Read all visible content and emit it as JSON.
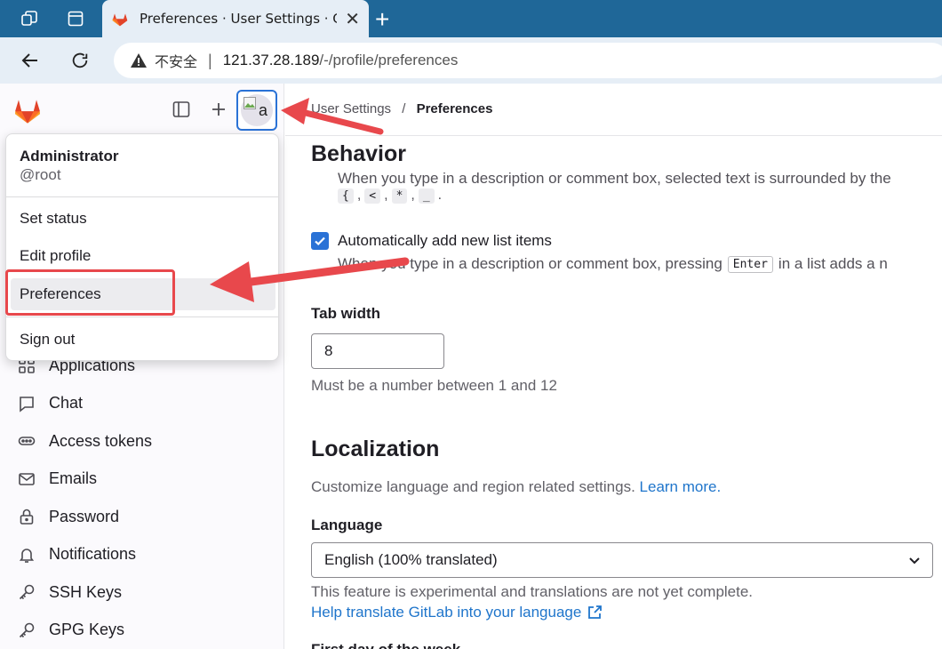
{
  "browser": {
    "tab_title": "Preferences · User Settings · GitLab",
    "security_label": "不安全",
    "url_host": "121.37.28.189",
    "url_path": "/-/profile/preferences"
  },
  "sidebar": {
    "nav_items": [
      {
        "label": "Applications",
        "icon": "applications-icon"
      },
      {
        "label": "Chat",
        "icon": "chat-icon"
      },
      {
        "label": "Access tokens",
        "icon": "token-icon"
      },
      {
        "label": "Emails",
        "icon": "mail-icon"
      },
      {
        "label": "Password",
        "icon": "lock-icon"
      },
      {
        "label": "Notifications",
        "icon": "bell-icon"
      },
      {
        "label": "SSH Keys",
        "icon": "key-icon"
      },
      {
        "label": "GPG Keys",
        "icon": "key-icon"
      }
    ],
    "avatar_alt": "a"
  },
  "user_menu": {
    "name": "Administrator",
    "handle": "@root",
    "items": [
      "Set status",
      "Edit profile",
      "Preferences",
      "Sign out"
    ],
    "active_item": "Preferences"
  },
  "breadcrumb": {
    "parent": "User Settings",
    "separator": "/",
    "current": "Preferences"
  },
  "behavior": {
    "heading": "Behavior",
    "cut_text": "When you type in a description or comment box, selected text is surrounded by the",
    "keys": [
      "{",
      "<",
      "*",
      "_"
    ],
    "auto_list_label": "Automatically add new list items",
    "auto_list_checked": true,
    "auto_list_help_before": "When you type in a description or comment box, pressing",
    "auto_list_help_key": "Enter",
    "auto_list_help_after": "in a list adds a n",
    "tab_width_label": "Tab width",
    "tab_width_value": "8",
    "tab_width_help": "Must be a number between 1 and 12"
  },
  "localization": {
    "heading": "Localization",
    "description": "Customize language and region related settings.",
    "learn_more": "Learn more.",
    "language_label": "Language",
    "language_value": "English (100% translated)",
    "experimental_note": "This feature is experimental and translations are not yet complete.",
    "help_translate": "Help translate GitLab into your language",
    "next_label": "First day of the week"
  },
  "colors": {
    "accent": "#1f75cb",
    "annotation": "#e8484c",
    "browser_frame": "#1f6798"
  }
}
